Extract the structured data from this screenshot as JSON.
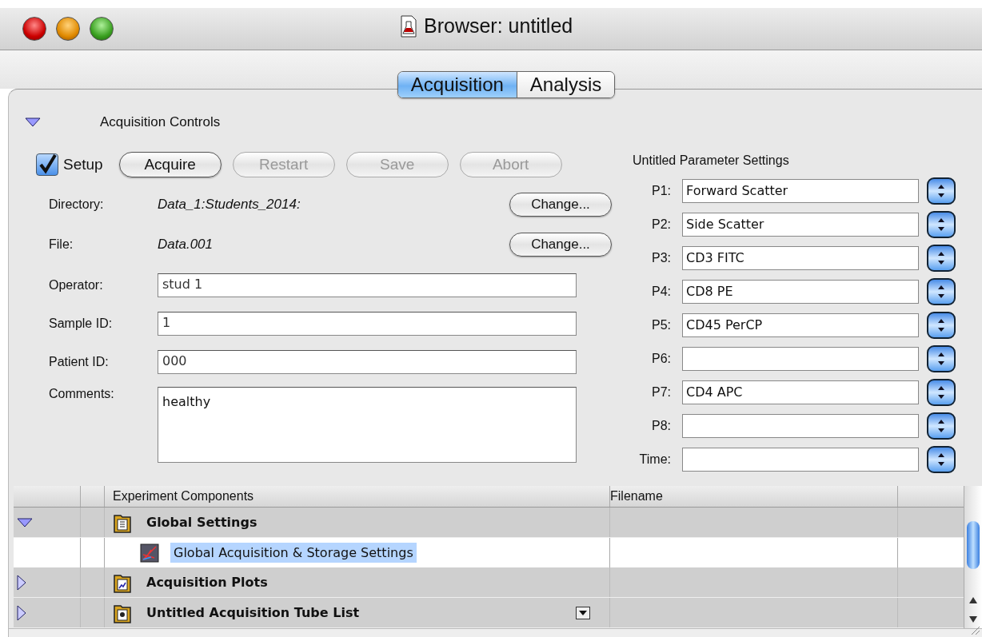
{
  "window": {
    "title": "Browser: untitled"
  },
  "tabs": [
    {
      "label": "Acquisition",
      "selected": true
    },
    {
      "label": "Analysis",
      "selected": false
    }
  ],
  "section": {
    "title": "Acquisition Controls",
    "expanded": true
  },
  "setup": {
    "label": "Setup",
    "checked": true
  },
  "buttons": [
    {
      "label": "Acquire",
      "disabled": false
    },
    {
      "label": "Restart",
      "disabled": true
    },
    {
      "label": "Save",
      "disabled": true
    },
    {
      "label": "Abort",
      "disabled": true
    }
  ],
  "locations": [
    {
      "label": "Directory:",
      "value": "Data_1:Students_2014:",
      "button": "Change..."
    },
    {
      "label": "File:",
      "value": "Data.001",
      "button": "Change..."
    }
  ],
  "fields": [
    {
      "label": "Operator:",
      "value": "stud 1",
      "kind": "line"
    },
    {
      "label": "Sample ID:",
      "value": "1",
      "kind": "line"
    },
    {
      "label": "Patient ID:",
      "value": "000",
      "kind": "line"
    },
    {
      "label": "Comments:",
      "value": "healthy",
      "kind": "area"
    }
  ],
  "parameters": {
    "title": "Untitled Parameter Settings",
    "items": [
      {
        "label": "P1:",
        "value": "Forward Scatter"
      },
      {
        "label": "P2:",
        "value": "Side Scatter"
      },
      {
        "label": "P3:",
        "value": "CD3 FITC"
      },
      {
        "label": "P4:",
        "value": "CD8 PE"
      },
      {
        "label": "P5:",
        "value": "CD45 PerCP"
      },
      {
        "label": "P6:"
      },
      {
        "label": "P7:",
        "value": "CD4 APC"
      },
      {
        "label": "P8:"
      },
      {
        "label": "Time:"
      }
    ]
  },
  "table": {
    "columns": [
      "Experiment Components",
      "Filename"
    ],
    "rows": [
      {
        "label": "Global Settings",
        "kind": "settings",
        "expanded": true,
        "selected": false,
        "children": [
          {
            "label": "Global Acquisition & Storage Settings",
            "kind": "acquisition",
            "selected": true
          }
        ]
      },
      {
        "label": "Acquisition Plots",
        "kind": "plots",
        "expanded": false,
        "selected": false
      },
      {
        "label": "Untitled Acquisition Tube List",
        "kind": "tubes",
        "expanded": false,
        "selected": false,
        "has_menu": true
      }
    ]
  }
}
